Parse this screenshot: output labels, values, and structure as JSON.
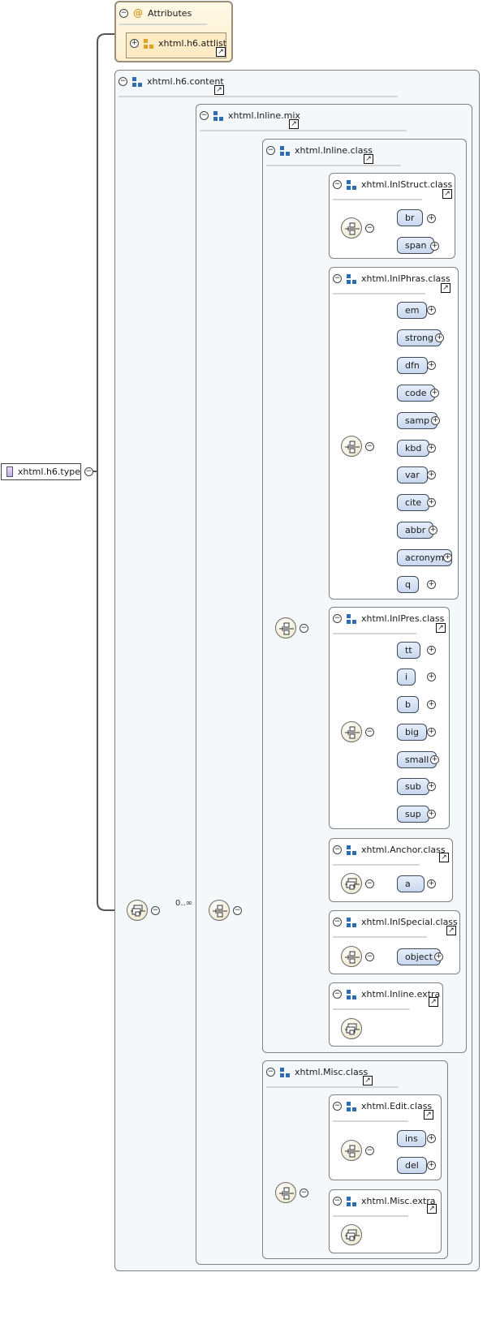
{
  "root_type": {
    "label": "xhtml.h6.type",
    "toggle": "−"
  },
  "attributes": {
    "title": "Attributes",
    "toggle": "−",
    "attlist": "xhtml.h6.attlist",
    "attlist_toggle": "+"
  },
  "content": {
    "label": "xhtml.h6.content",
    "toggle": "−"
  },
  "inline_mix": {
    "label": "xhtml.Inline.mix",
    "toggle": "−"
  },
  "inline_class": {
    "label": "xhtml.Inline.class",
    "toggle": "−"
  },
  "groups": {
    "inlstruct": {
      "label": "xhtml.InlStruct.class",
      "toggle": "−",
      "elements": [
        "br",
        "span"
      ]
    },
    "inlphras": {
      "label": "xhtml.InlPhras.class",
      "toggle": "−",
      "elements": [
        "em",
        "strong",
        "dfn",
        "code",
        "samp",
        "kbd",
        "var",
        "cite",
        "abbr",
        "acronym",
        "q"
      ]
    },
    "inlpres": {
      "label": "xhtml.InlPres.class",
      "toggle": "−",
      "elements": [
        "tt",
        "i",
        "b",
        "big",
        "small",
        "sub",
        "sup"
      ]
    },
    "anchor": {
      "label": "xhtml.Anchor.class",
      "toggle": "−",
      "elements": [
        "a"
      ]
    },
    "inlspecial": {
      "label": "xhtml.InlSpecial.class",
      "toggle": "−",
      "elements": [
        "object"
      ]
    },
    "inlineextra": {
      "label": "xhtml.Inline.extra",
      "toggle": "−",
      "elements": []
    },
    "edit": {
      "label": "xhtml.Edit.class",
      "toggle": "−",
      "elements": [
        "ins",
        "del"
      ]
    },
    "miscextra": {
      "label": "xhtml.Misc.extra",
      "toggle": "−",
      "elements": []
    }
  },
  "misc_class": {
    "label": "xhtml.Misc.class",
    "toggle": "−"
  },
  "occurrence": "0..∞",
  "toggles": {
    "minus": "−",
    "plus": "+"
  },
  "ref_glyph": "↗"
}
